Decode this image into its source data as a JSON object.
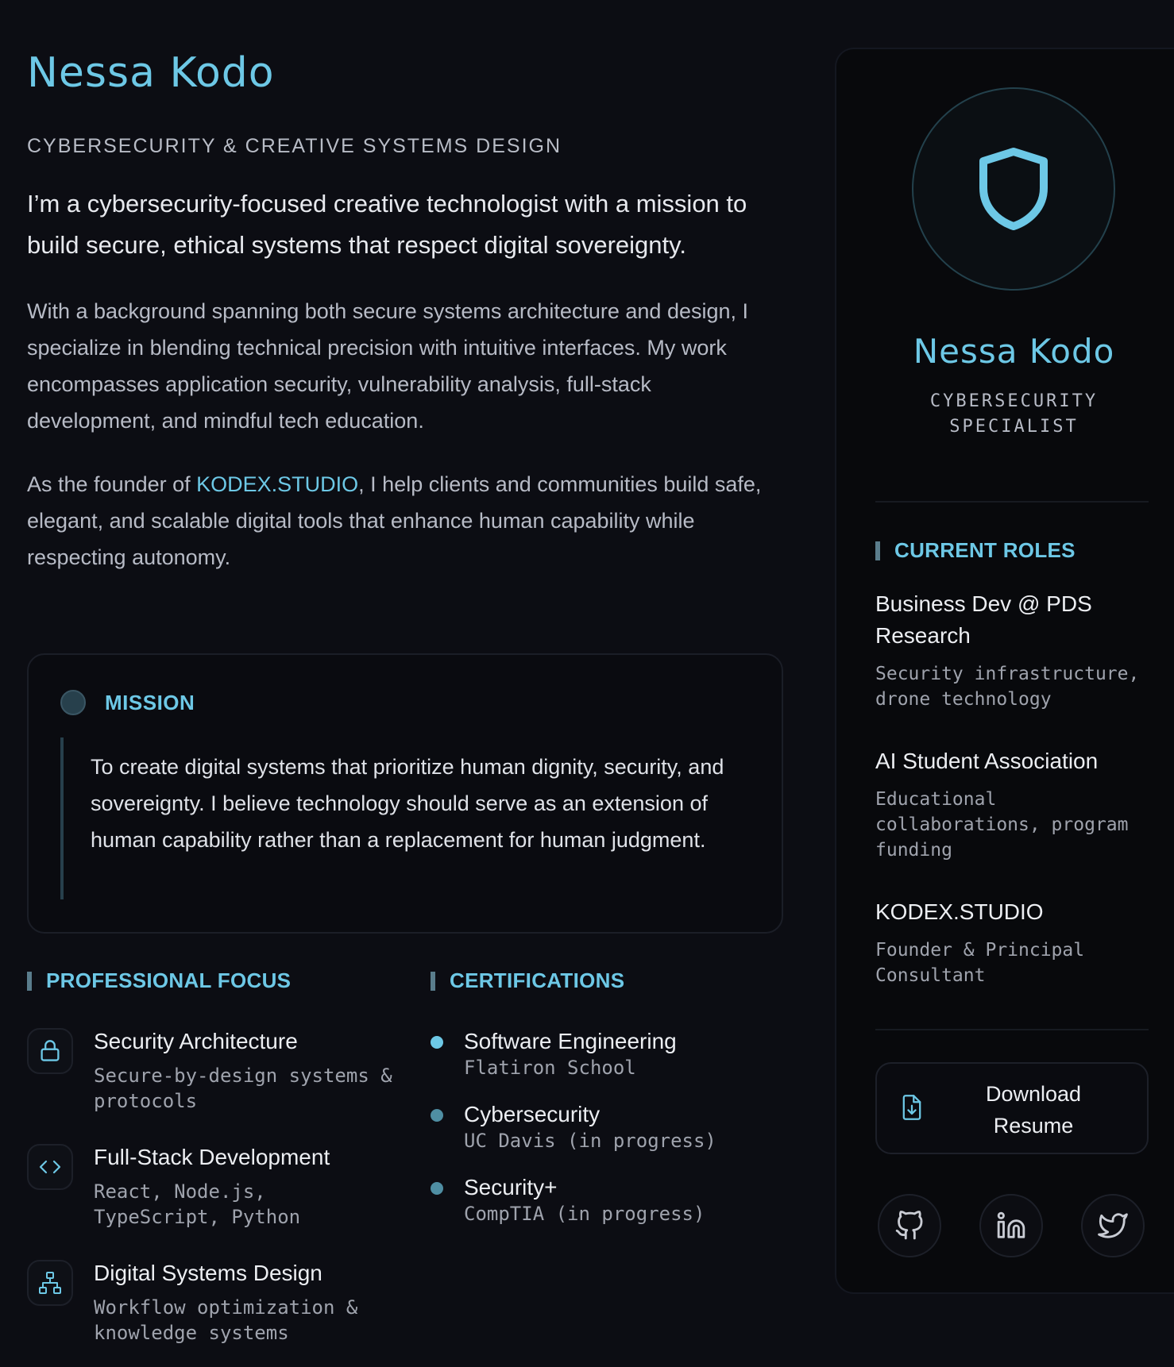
{
  "profile": {
    "name": "Nessa Kodo",
    "subtitle": "CYBERSECURITY & CREATIVE SYSTEMS DESIGN",
    "lead": "I’m a cybersecurity-focused creative technologist with a mission to build secure, ethical systems that respect digital sovereignty.",
    "para1": "With a background spanning both secure systems architecture and design, I specialize in blending technical precision with intuitive interfaces. My work encompasses application security, vulnerability analysis, full-stack development, and mindful tech education.",
    "para2_before": "As the founder of ",
    "para2_link": "KODEX.STUDIO",
    "para2_after": ", I help clients and communities build safe, elegant, and scalable digital tools that enhance human capability while respecting autonomy."
  },
  "mission": {
    "label": "MISSION",
    "text": "To create digital systems that prioritize human dignity, security, and sovereignty. I believe technology should serve as an extension of human capability rather than a replacement for human judgment."
  },
  "focus": {
    "title": "PROFESSIONAL FOCUS",
    "items": [
      {
        "icon": "lock-icon",
        "title": "Security Architecture",
        "desc": "Secure-by-design systems & protocols"
      },
      {
        "icon": "code-icon",
        "title": "Full-Stack Development",
        "desc": "React, Node.js, TypeScript, Python"
      },
      {
        "icon": "sitemap-icon",
        "title": "Digital Systems Design",
        "desc": "Workflow optimization & knowledge systems"
      }
    ]
  },
  "certifications": {
    "title": "CERTIFICATIONS",
    "items": [
      {
        "title": "Software Engineering",
        "sub": "Flatiron School",
        "dot_color": "#6dc8e6"
      },
      {
        "title": "Cybersecurity",
        "sub": "UC Davis (in progress)",
        "dot_color": "#4f8ea3"
      },
      {
        "title": "Security+",
        "sub": "CompTIA (in progress)",
        "dot_color": "#4f8ea3"
      }
    ]
  },
  "panel": {
    "avatar_icon": "shield-icon",
    "name": "Nessa Kodo",
    "role": "CYBERSECURITY SPECIALIST",
    "roles_title": "CURRENT ROLES",
    "roles": [
      {
        "title": "Business Dev @ PDS Research",
        "desc": "Security infrastructure, drone technology"
      },
      {
        "title": "AI Student Association",
        "desc": "Educational collaborations, program funding"
      },
      {
        "title": "KODEX.STUDIO",
        "desc": "Founder & Principal Consultant"
      }
    ],
    "download_label": "Download Resume",
    "download_icon": "file-download-icon",
    "socials": [
      "github-icon",
      "linkedin-icon",
      "twitter-icon"
    ]
  },
  "colors": {
    "accent": "#6dc8e6",
    "background": "#0c0d13",
    "panel": "#08090c"
  }
}
